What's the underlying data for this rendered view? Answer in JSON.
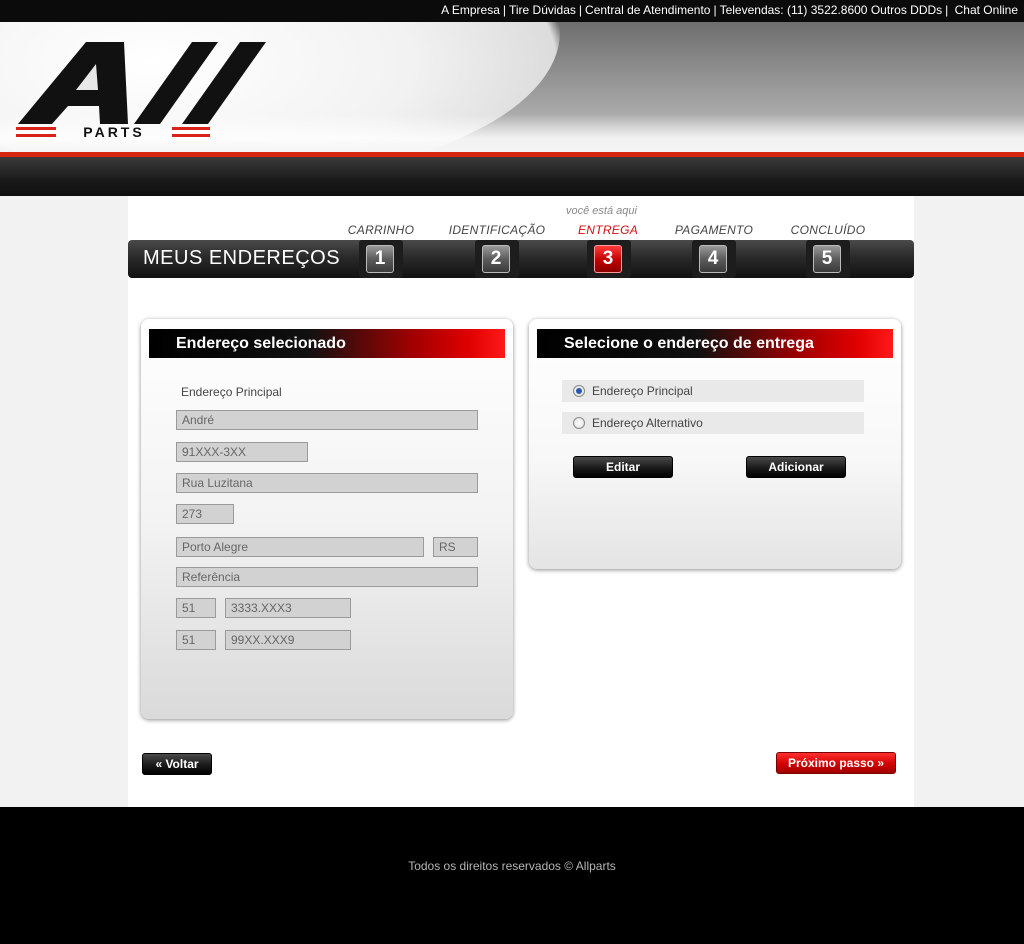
{
  "topbar": {
    "links": [
      "A Empresa",
      "Tire Dúvidas",
      "Central de Atendimento",
      "Televendas: (11) 3522.8600 Outros DDDs",
      "Chat Online"
    ]
  },
  "logo": {
    "brand": "All",
    "sub": "PARTS"
  },
  "steps": {
    "here_label": "você está aqui",
    "title": "MEUS ENDEREÇOS",
    "items": [
      {
        "label": "CARRINHO",
        "number": "1"
      },
      {
        "label": "IDENTIFICAÇÃO",
        "number": "2"
      },
      {
        "label": "ENTREGA",
        "number": "3"
      },
      {
        "label": "PAGAMENTO",
        "number": "4"
      },
      {
        "label": "CONCLUÍDO",
        "number": "5"
      }
    ],
    "active_index": 2
  },
  "selected_address": {
    "header": "Endereço selecionado",
    "label": "Endereço Principal",
    "name": "André",
    "cep": "91XXX-3XX",
    "street": "Rua Luzitana",
    "number": "273",
    "city": "Porto Alegre",
    "state": "RS",
    "reference": "Referência",
    "phone1_ddd": "51",
    "phone1": "3333.XXX3",
    "phone2_ddd": "51",
    "phone2": "99XX.XXX9"
  },
  "delivery": {
    "header": "Selecione o endereço de entrega",
    "options": [
      {
        "label": "Endereço Principal",
        "selected": true
      },
      {
        "label": "Endereço Alternativo",
        "selected": false
      }
    ],
    "edit_label": "Editar",
    "add_label": "Adicionar"
  },
  "nav": {
    "back_label": "« Voltar",
    "next_label": "Próximo passo »"
  },
  "footer": {
    "copyright": "Todos os direitos reservados © Allparts"
  },
  "colors": {
    "accent_red": "#d11010",
    "dark": "#111111"
  }
}
